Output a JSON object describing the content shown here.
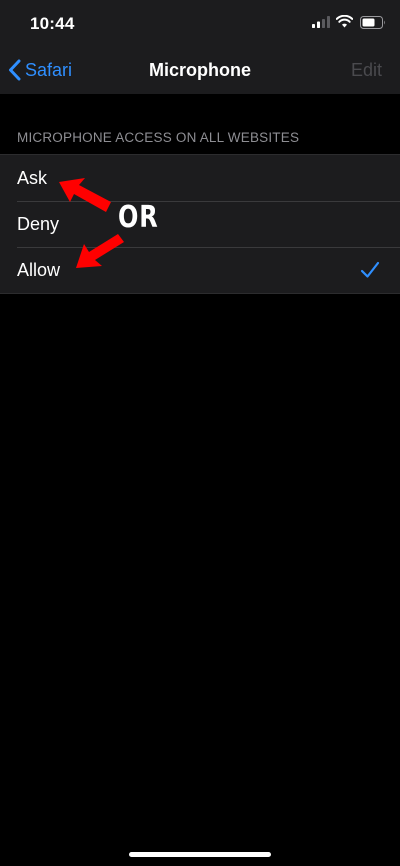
{
  "status_bar": {
    "time": "10:44"
  },
  "nav": {
    "back_label": "Safari",
    "title": "Microphone",
    "edit_label": "Edit"
  },
  "section": {
    "header": "MICROPHONE ACCESS ON ALL WEBSITES"
  },
  "options": [
    {
      "label": "Ask",
      "selected": false
    },
    {
      "label": "Deny",
      "selected": false
    },
    {
      "label": "Allow",
      "selected": true
    }
  ],
  "annotation": {
    "or_text": "OR",
    "arrow_color": "#ff0000"
  },
  "colors": {
    "accent": "#2f8fff",
    "background": "#000000",
    "cell_background": "#1c1c1e",
    "secondary_text": "#8e8e93",
    "disabled_text": "#4a4a4e"
  }
}
